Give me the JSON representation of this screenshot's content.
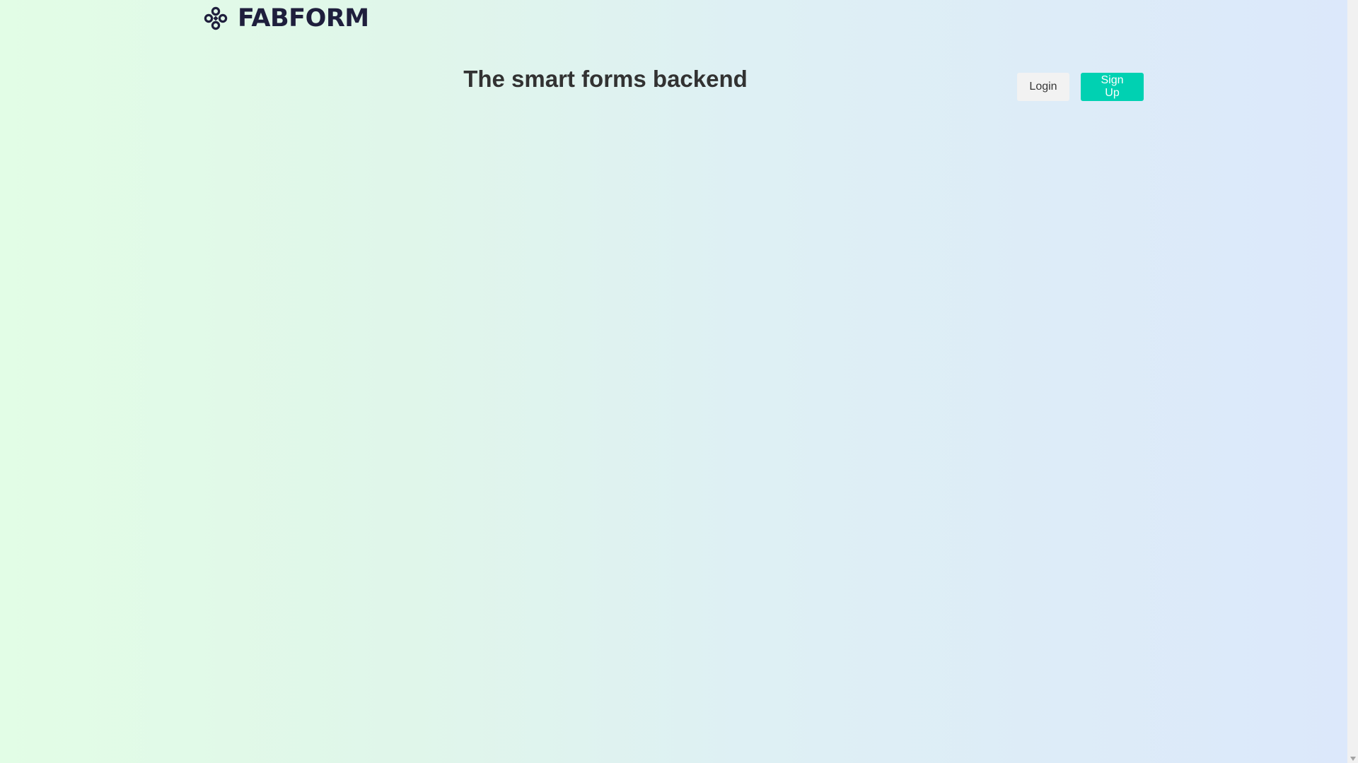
{
  "header": {
    "logo_text": "FABFORM",
    "logo_icon": "clover-knot-icon"
  },
  "hero": {
    "title": "The smart forms backend"
  },
  "auth": {
    "login_label": "Login",
    "signup_label": "Sign Up"
  },
  "colors": {
    "brand_dark": "#1f1f3d",
    "signup_accent": "#00d1b2",
    "login_bg": "#f2f2f2",
    "gradient_left": "#e2fde6",
    "gradient_right": "#dce8fb"
  }
}
